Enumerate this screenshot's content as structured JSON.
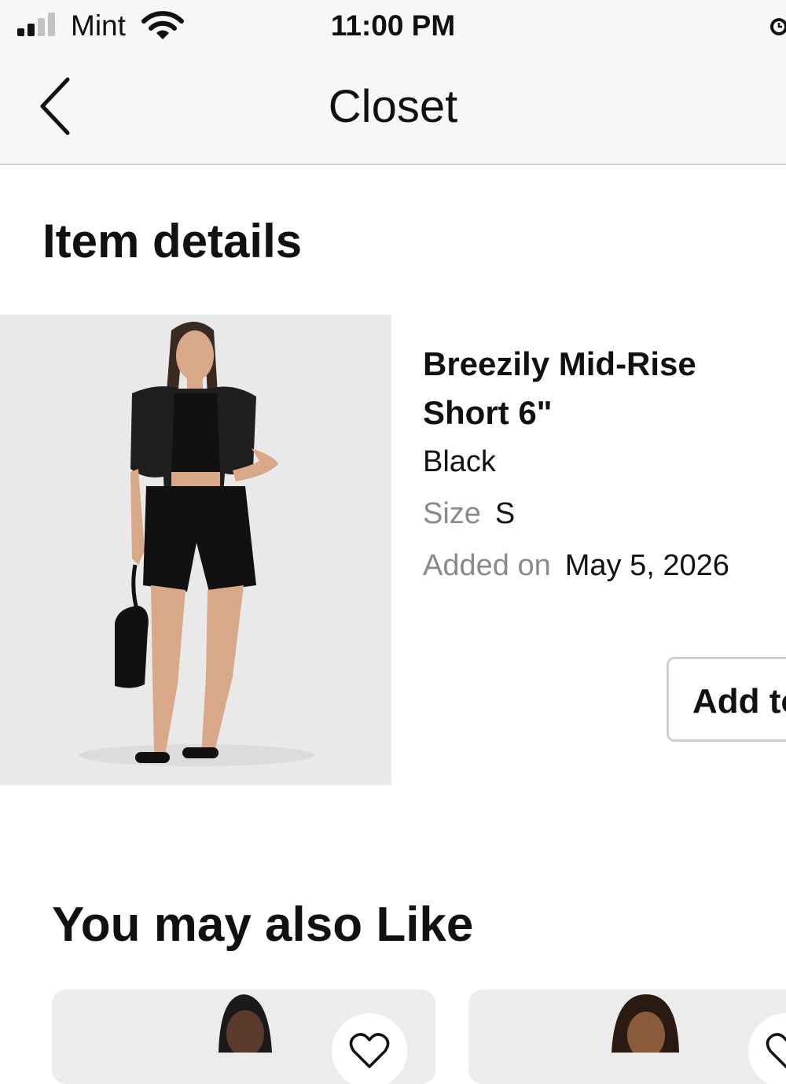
{
  "status_bar": {
    "carrier": "Mint",
    "time": "11:00 PM",
    "icons": [
      "signal-icon",
      "wifi-icon",
      "alarm-icon"
    ]
  },
  "nav": {
    "title": "Closet",
    "back_icon": "chevron-left-icon"
  },
  "item_details": {
    "heading": "Item details",
    "product_name": "Breezily Mid-Rise Short 6\"",
    "color": "Black",
    "size_label": "Size",
    "size_value": "S",
    "added_label": "Added on",
    "added_value": "May 5, 2026",
    "add_button_label": "Add to"
  },
  "recommendations": {
    "heading": "You may also Like",
    "cards": [
      {
        "favorite_icon": "heart-icon"
      },
      {
        "favorite_icon": "heart-icon"
      }
    ]
  },
  "colors": {
    "bar_background": "#f7f7f7",
    "divider": "#cfcfcf",
    "muted_text": "#8a8a8a",
    "image_background": "#e9e9ea"
  }
}
